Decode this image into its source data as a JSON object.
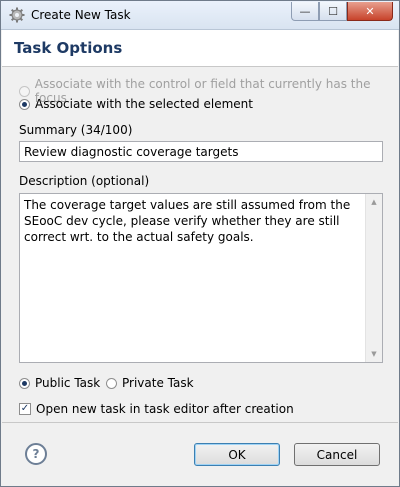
{
  "window": {
    "title": "Create New Task",
    "minimize_label": "—",
    "maximize_label": "☐",
    "close_label": "✕"
  },
  "header": {
    "title": "Task Options"
  },
  "association": {
    "option_focus": "Associate with the control or field that currently has the focus",
    "option_selected": "Associate with the selected element",
    "selected": "selected_element"
  },
  "summary": {
    "label": "Summary (34/100)",
    "value": "Review diagnostic coverage targets"
  },
  "description": {
    "label": "Description (optional)",
    "value": "The coverage target values are still assumed from the SEooC dev cycle, please verify whether they are still correct wrt. to the actual safety goals."
  },
  "visibility": {
    "public_label": "Public Task",
    "private_label": "Private Task",
    "selected": "public"
  },
  "open_in_editor": {
    "label": "Open new task in task editor after creation",
    "checked": true
  },
  "footer": {
    "help_label": "?",
    "ok_label": "OK",
    "cancel_label": "Cancel"
  },
  "icons": {
    "title_icon": "gear-icon",
    "help_icon": "help-icon",
    "scroll_up": "scroll-up-arrow-icon",
    "scroll_down": "scroll-down-arrow-icon"
  },
  "colors": {
    "header_title": "#1e3a64",
    "title_bar": "#dfe8f4",
    "close_button": "#c7432b"
  }
}
